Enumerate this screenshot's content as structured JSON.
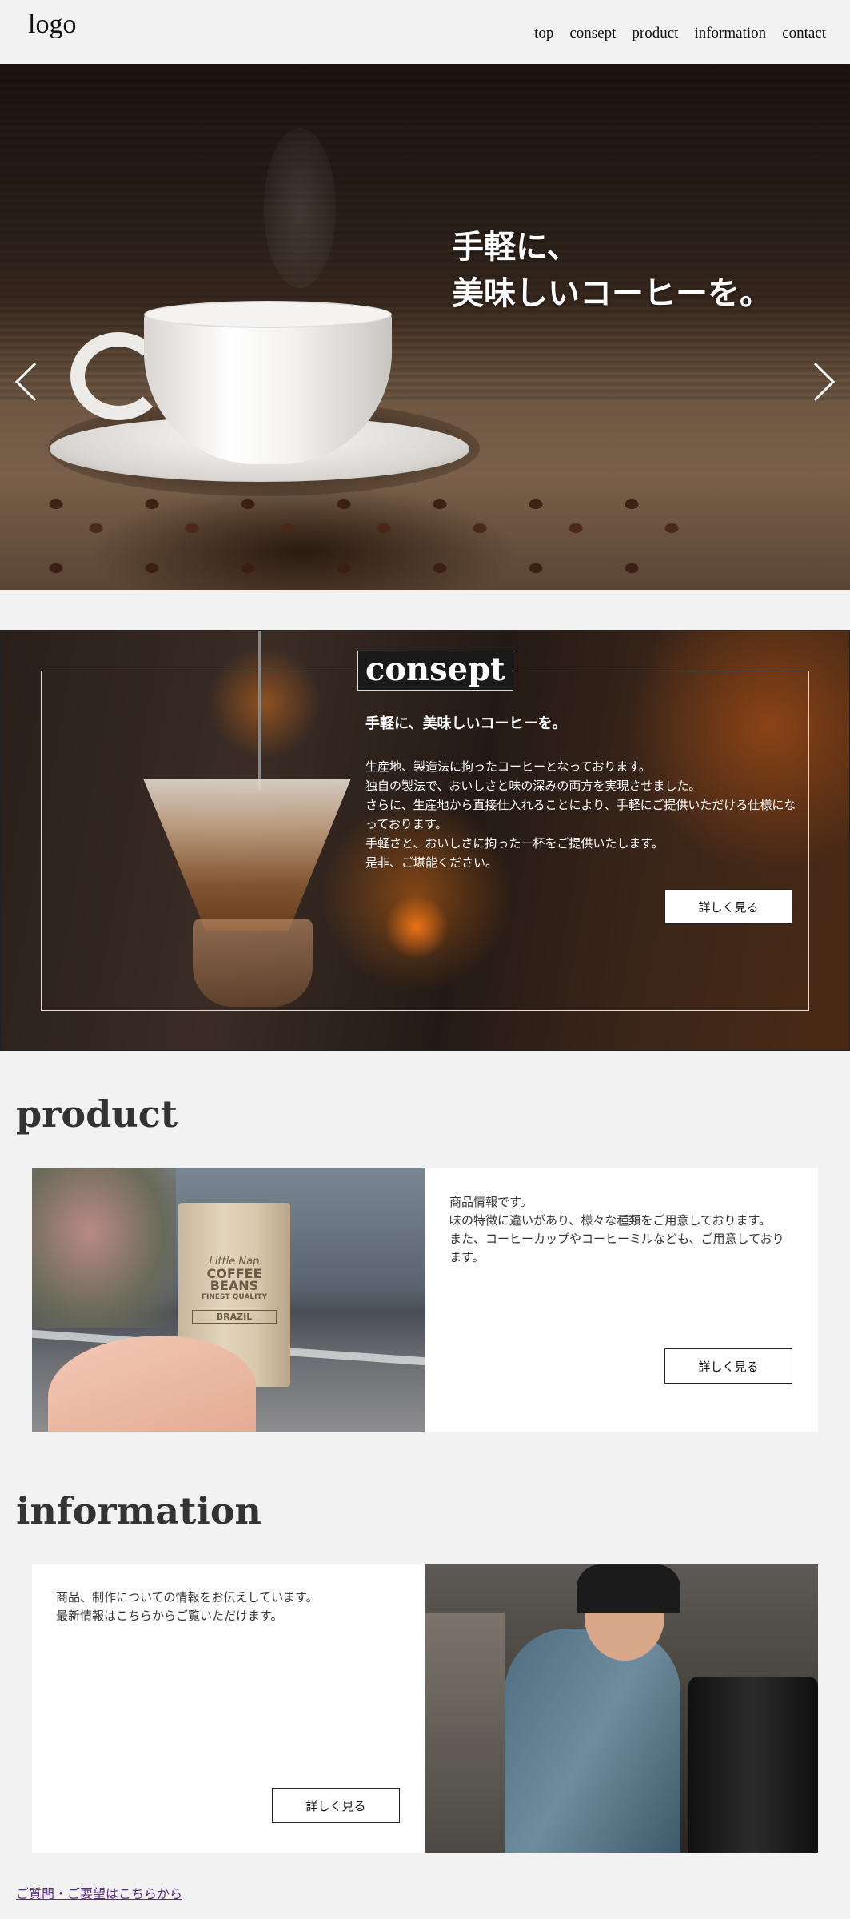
{
  "header": {
    "logo": "logo",
    "nav": [
      "top",
      "consept",
      "product",
      "information",
      "contact"
    ]
  },
  "hero": {
    "line1": "手軽に、",
    "line2": "美味しいコーヒーを。"
  },
  "concept": {
    "title": "consept",
    "lead": "手軽に、美味しいコーヒーを。",
    "body": [
      "生産地、製造法に拘ったコーヒーとなっております。",
      "独自の製法で、おいしさと味の深みの両方を実現させました。",
      "さらに、生産地から直接仕入れることにより、手軽にご提供いただける仕様になっております。",
      "手軽さと、おいしさに拘った一杯をご提供いたします。",
      "是非、ご堪能ください。"
    ],
    "button": "詳しく見る"
  },
  "product": {
    "title": "product",
    "body": [
      "商品情報です。",
      "味の特徴に違いがあり、様々な種類をご用意しております。",
      "また、コーヒーカップやコーヒーミルなども、ご用意しております。"
    ],
    "bag_text": [
      "Little Nap",
      "COFFEE",
      "BEANS",
      "FINEST QUALITY",
      "BRAZIL"
    ],
    "button": "詳しく見る"
  },
  "information": {
    "title": "information",
    "body": [
      "商品、制作についての情報をお伝えしています。",
      "最新情報はこちらからご覧いただけます。"
    ],
    "button": "詳しく見る"
  },
  "footer": {
    "link": "ご質問・ご要望はこちらから"
  }
}
